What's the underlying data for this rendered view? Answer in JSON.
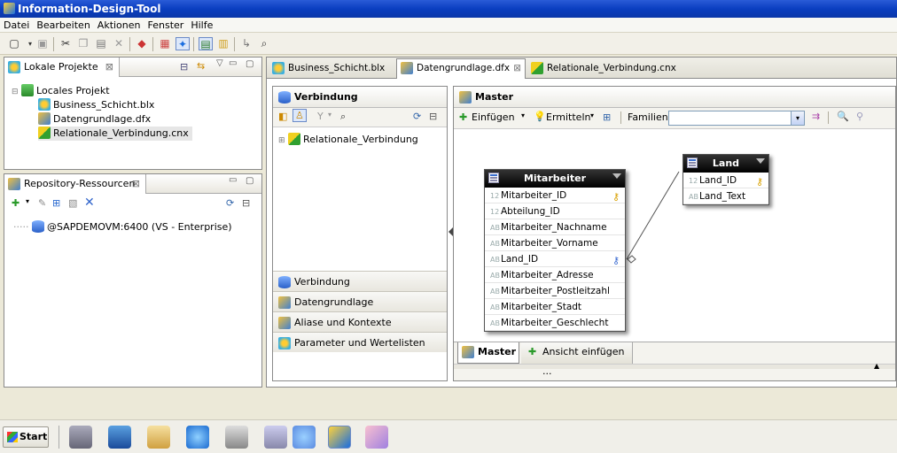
{
  "window": {
    "title": "Information-Design-Tool"
  },
  "menu": [
    "Datei",
    "Bearbeiten",
    "Aktionen",
    "Fenster",
    "Hilfe"
  ],
  "local_projects": {
    "tab_label": "Lokale Projekte",
    "project": "Locales Projekt",
    "items": [
      "Business_Schicht.blx",
      "Datengrundlage.dfx",
      "Relationale_Verbindung.cnx"
    ]
  },
  "repository": {
    "tab_label": "Repository-Ressourcen",
    "server": "@SAPDEMOVM:6400 (VS - Enterprise)"
  },
  "editor_tabs": [
    "Business_Schicht.blx",
    "Datengrundlage.dfx",
    "Relationale_Verbindung.cnx"
  ],
  "connection_panel": {
    "title": "Verbindung",
    "tree_item": "Relationale_Verbindung",
    "sections": [
      "Verbindung",
      "Datengrundlage",
      "Aliase und Kontexte",
      "Parameter und Wertelisten"
    ]
  },
  "master_panel": {
    "title": "Master",
    "toolbar": {
      "insert": "Einfügen",
      "detect": "Ermitteln",
      "families": "Familien"
    },
    "bottom_tabs": {
      "master": "Master",
      "insert_view": "Ansicht einfügen ..."
    }
  },
  "tables": {
    "mitarbeiter": {
      "name": "Mitarbeiter",
      "columns": [
        {
          "type": "12",
          "name": "Mitarbeiter_ID",
          "key": "primary"
        },
        {
          "type": "12",
          "name": "Abteilung_ID",
          "key": ""
        },
        {
          "type": "AB",
          "name": "Mitarbeiter_Nachname",
          "key": ""
        },
        {
          "type": "AB",
          "name": "Mitarbeiter_Vorname",
          "key": ""
        },
        {
          "type": "AB",
          "name": "Land_ID",
          "key": "foreign"
        },
        {
          "type": "AB",
          "name": "Mitarbeiter_Adresse",
          "key": ""
        },
        {
          "type": "AB",
          "name": "Mitarbeiter_Postleitzahl",
          "key": ""
        },
        {
          "type": "AB",
          "name": "Mitarbeiter_Stadt",
          "key": ""
        },
        {
          "type": "AB",
          "name": "Mitarbeiter_Geschlecht",
          "key": ""
        }
      ]
    },
    "land": {
      "name": "Land",
      "columns": [
        {
          "type": "12",
          "name": "Land_ID",
          "key": "primary"
        },
        {
          "type": "AB",
          "name": "Land_Text",
          "key": ""
        }
      ]
    }
  },
  "taskbar": {
    "start": "Start"
  },
  "colors": {
    "title_bar": "#0a3ec0",
    "accent": "#316ac5",
    "key_icon": "#d8a000"
  }
}
